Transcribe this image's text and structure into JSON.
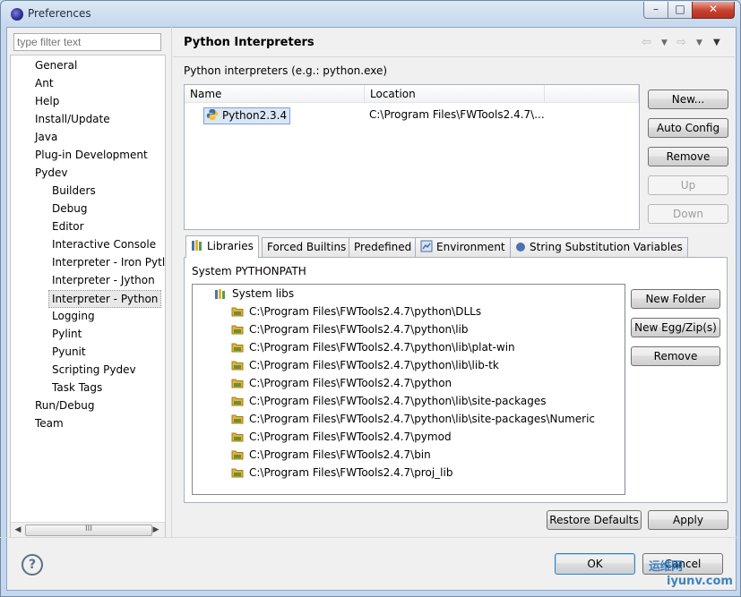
{
  "window": {
    "title": "Preferences",
    "controls": {
      "minimize": "–",
      "maximize": "□",
      "close": "✕"
    }
  },
  "sidebar": {
    "filter_placeholder": "type filter text",
    "items": [
      {
        "label": "General"
      },
      {
        "label": "Ant"
      },
      {
        "label": "Help"
      },
      {
        "label": "Install/Update"
      },
      {
        "label": "Java"
      },
      {
        "label": "Plug-in Development"
      },
      {
        "label": "Pydev"
      },
      {
        "label": "Builders"
      },
      {
        "label": "Debug"
      },
      {
        "label": "Editor"
      },
      {
        "label": "Interactive Console"
      },
      {
        "label": "Interpreter - Iron Pytl"
      },
      {
        "label": "Interpreter - Jython"
      },
      {
        "label": "Interpreter - Python"
      },
      {
        "label": "Logging"
      },
      {
        "label": "Pylint"
      },
      {
        "label": "Pyunit"
      },
      {
        "label": "Scripting Pydev"
      },
      {
        "label": "Task Tags"
      },
      {
        "label": "Run/Debug"
      },
      {
        "label": "Team"
      }
    ],
    "selected": "Interpreter - Python",
    "scroll_grip": "III"
  },
  "main": {
    "title": "Python Interpreters",
    "description": "Python interpreters (e.g.: python.exe)",
    "table": {
      "columns": [
        "Name",
        "Location"
      ],
      "rows": [
        {
          "name": "Python2.3.4",
          "location": "C:\\Program Files\\FWTools2.4.7\\..."
        }
      ]
    },
    "side_buttons": {
      "new": "New...",
      "auto_config": "Auto Config",
      "remove": "Remove",
      "up": "Up",
      "down": "Down"
    },
    "tabs": [
      {
        "label": "Libraries",
        "active": true
      },
      {
        "label": "Forced Builtins"
      },
      {
        "label": "Predefined"
      },
      {
        "label": "Environment"
      },
      {
        "label": "String Substitution Variables"
      }
    ],
    "libraries": {
      "section_label": "System PYTHONPATH",
      "root": "System libs",
      "paths": [
        "C:\\Program Files\\FWTools2.4.7\\python\\DLLs",
        "C:\\Program Files\\FWTools2.4.7\\python\\lib",
        "C:\\Program Files\\FWTools2.4.7\\python\\lib\\plat-win",
        "C:\\Program Files\\FWTools2.4.7\\python\\lib\\lib-tk",
        "C:\\Program Files\\FWTools2.4.7\\python",
        "C:\\Program Files\\FWTools2.4.7\\python\\lib\\site-packages",
        "C:\\Program Files\\FWTools2.4.7\\python\\lib\\site-packages\\Numeric",
        "C:\\Program Files\\FWTools2.4.7\\pymod",
        "C:\\Program Files\\FWTools2.4.7\\bin",
        "C:\\Program Files\\FWTools2.4.7\\proj_lib"
      ],
      "buttons": {
        "new_folder": "New Folder",
        "new_egg": "New Egg/Zip(s)",
        "remove": "Remove"
      }
    },
    "restore_defaults": "Restore Defaults",
    "apply": "Apply"
  },
  "footer": {
    "help": "?",
    "ok": "OK",
    "cancel": "Cancel"
  },
  "watermark": {
    "line1": "运维网",
    "line2": "iyunv.com"
  },
  "colors": {
    "accent": "#3c7fb1",
    "selection_bg": "#dbe7f6",
    "folder": "#e0b33a"
  }
}
